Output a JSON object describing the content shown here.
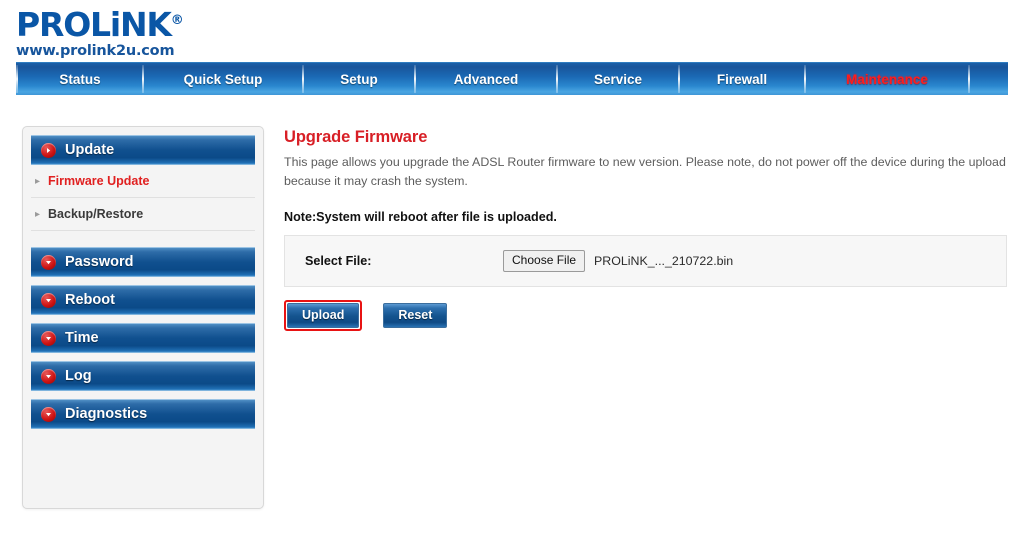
{
  "brand": {
    "name": "PROLiNK",
    "registered_mark": "®",
    "url": "www.prolink2u.com"
  },
  "nav": {
    "tabs": [
      {
        "label": "Status",
        "active": false
      },
      {
        "label": "Quick Setup",
        "active": false
      },
      {
        "label": "Setup",
        "active": false
      },
      {
        "label": "Advanced",
        "active": false
      },
      {
        "label": "Service",
        "active": false
      },
      {
        "label": "Firewall",
        "active": false
      },
      {
        "label": "Maintenance",
        "active": true
      }
    ],
    "active_color": "#ff1c1c",
    "inactive_color": "#ffffff"
  },
  "sidebar": {
    "sections": [
      {
        "label": "Update",
        "icon": "arrow-right-badge-icon",
        "expanded": true
      },
      {
        "label": "Password",
        "icon": "chevron-down-badge-icon",
        "expanded": false
      },
      {
        "label": "Reboot",
        "icon": "chevron-down-badge-icon",
        "expanded": false
      },
      {
        "label": "Time",
        "icon": "chevron-down-badge-icon",
        "expanded": false
      },
      {
        "label": "Log",
        "icon": "chevron-down-badge-icon",
        "expanded": false
      },
      {
        "label": "Diagnostics",
        "icon": "chevron-down-badge-icon",
        "expanded": false
      }
    ],
    "sub_items": [
      {
        "label": "Firmware Update",
        "selected": true
      },
      {
        "label": "Backup/Restore",
        "selected": false
      }
    ],
    "selected_color": "#e02020"
  },
  "main": {
    "title": "Upgrade Firmware",
    "title_color": "#d81f26",
    "description": "This page allows you upgrade the ADSL Router firmware to new version. Please note, do not power off the device during the upload because it may crash the system.",
    "note": "Note:System will reboot after file is uploaded.",
    "file_row": {
      "label": "Select File:",
      "choose_button": "Choose File",
      "file_name": "PROLiNK_..._210722.bin"
    },
    "buttons": {
      "upload": "Upload",
      "reset": "Reset",
      "upload_highlight_color": "#e81313"
    }
  }
}
